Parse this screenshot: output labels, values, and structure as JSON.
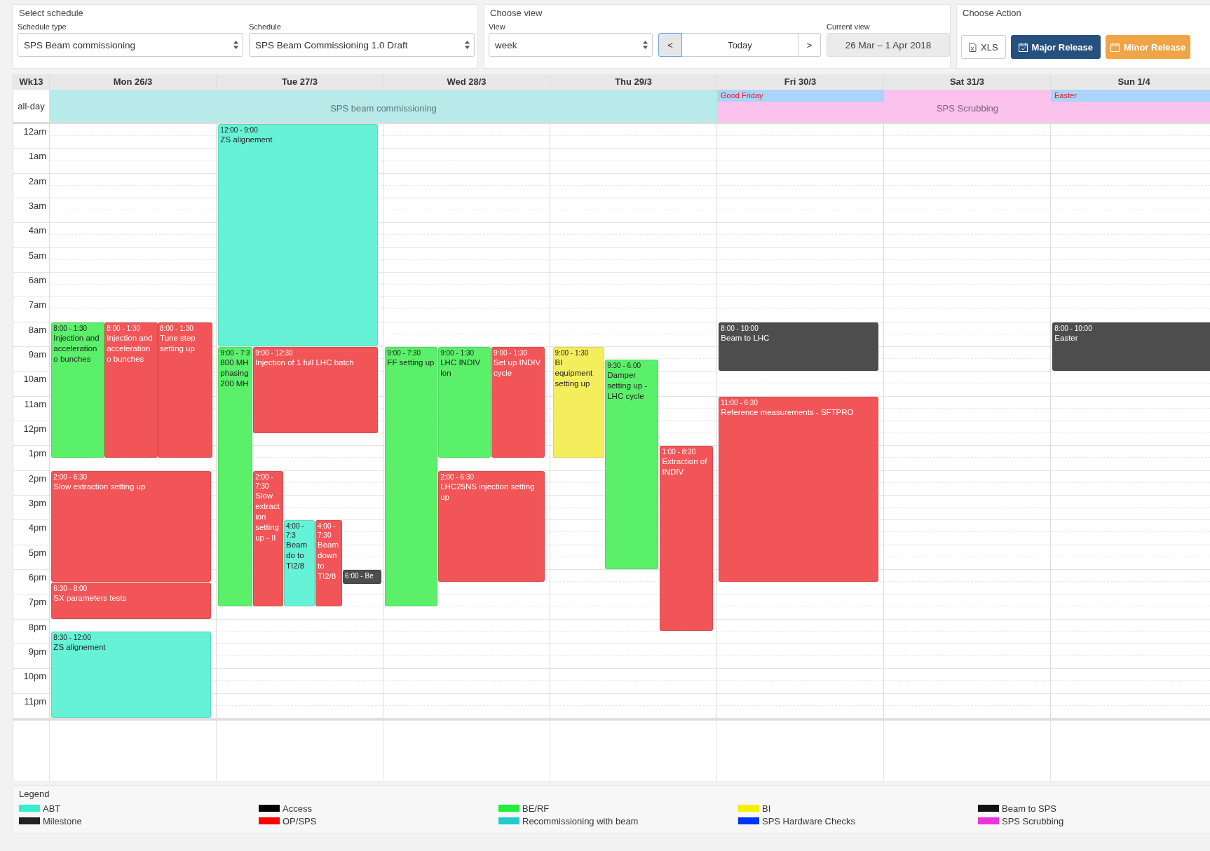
{
  "select_schedule": {
    "legend": "Select schedule",
    "fields": [
      {
        "label": "Schedule type",
        "value": "SPS Beam commissioning"
      },
      {
        "label": "Schedule",
        "value": "SPS Beam Commissioning 1.0 Draft"
      }
    ]
  },
  "choose_view": {
    "legend": "Choose view",
    "view_label": "View",
    "view_value": "week",
    "prev": "<",
    "today": "Today",
    "next": ">",
    "current_label": "Current view",
    "current_value": "26 Mar – 1 Apr 2018"
  },
  "choose_action": {
    "legend": "Choose Action",
    "buttons": [
      {
        "label": "XLS",
        "kind": "file"
      },
      {
        "label": "Major Release",
        "kind": "major"
      },
      {
        "label": "Minor Release",
        "kind": "minor"
      }
    ]
  },
  "calendar": {
    "week": "Wk13",
    "all_day_label": "all-day",
    "all_day": [
      {
        "title": "SPS beam commissioning",
        "color": "#b8eaea",
        "kind": "span"
      },
      {
        "title": "SPS Scrubbing",
        "color": "#fbc2ee",
        "kind": "span"
      },
      {
        "title": "Good Friday",
        "color": "#aad4f8",
        "kind": "flag"
      },
      {
        "title": "Easter",
        "color": "#aad4f8",
        "kind": "flag"
      }
    ],
    "hours": [
      "12am",
      "1am",
      "2am",
      "3am",
      "4am",
      "5am",
      "6am",
      "7am",
      "8am",
      "9am",
      "10am",
      "11am",
      "12pm",
      "1pm",
      "2pm",
      "3pm",
      "4pm",
      "5pm",
      "6pm",
      "7pm",
      "8pm",
      "9pm",
      "10pm",
      "11pm"
    ],
    "days": [
      {
        "label": "Mon 26/3",
        "events": [
          {
            "time": "8:00 - 1:30",
            "title": "Injection and acceleration o bunches",
            "color": "#5af06a"
          },
          {
            "time": "8:00 - 1:30",
            "title": "Injection and acceleration o bunches",
            "color": "#f25557"
          },
          {
            "time": "8:00 - 1:30",
            "title": "Tune step setting up",
            "color": "#f25557"
          },
          {
            "time": "2:00 - 6:30",
            "title": "Slow extraction setting up",
            "color": "#f25557"
          },
          {
            "time": "6:30 - 8:00",
            "title": "SX parameters tests",
            "color": "#f25557"
          },
          {
            "time": "8:30 - 12:00",
            "title": "ZS alignement",
            "color": "#66f2d6"
          }
        ]
      },
      {
        "label": "Tue 27/3",
        "events": [
          {
            "time": "12:00 - 9:00",
            "title": "ZS alignement",
            "color": "#66f2d6"
          },
          {
            "time": "9:00 - 7:3",
            "title": "800 MH phasing 200 MH",
            "color": "#5af06a"
          },
          {
            "time": "9:00 - 12:30",
            "title": "Injection of 1 full LHC batch",
            "color": "#f25557"
          },
          {
            "time": "2:00 - 7:30",
            "title": "Slow extraction setting up - II",
            "color": "#f25557"
          },
          {
            "time": "4:00 - 7:3",
            "title": "Beam do to TI2/8",
            "color": "#66f2d6"
          },
          {
            "time": "4:00 - 7:30",
            "title": "Beam down to TI2/8",
            "color": "#f25557"
          },
          {
            "time": "6:00 - Be",
            "color": "#4d4d4d"
          }
        ]
      },
      {
        "label": "Wed 28/3",
        "events": [
          {
            "time": "9:00 - 7:30",
            "title": "FF setting up",
            "color": "#5af06a"
          },
          {
            "time": "9:00 - 1:30",
            "title": "LHC INDIV lon",
            "color": "#5af06a"
          },
          {
            "time": "9:00 - 1:30",
            "title": "Set up INDIV cycle",
            "color": "#f25557"
          },
          {
            "time": "2:00 - 6:30",
            "title": "LHC25NS injection setting up",
            "color": "#f25557"
          }
        ]
      },
      {
        "label": "Thu 29/3",
        "events": [
          {
            "time": "9:00 - 1:30",
            "title": "BI equipment setting up",
            "color": "#f5ee5c"
          },
          {
            "time": "9:30 - 6:00",
            "title": "Damper setting up - LHC cycle",
            "color": "#5af06a"
          },
          {
            "time": "1:00 - 8:30",
            "title": "Extraction of INDIV",
            "color": "#f25557"
          }
        ]
      },
      {
        "label": "Fri 30/3",
        "events": [
          {
            "time": "8:00 - 10:00",
            "title": "Beam to LHC",
            "color": "#4d4d4d"
          },
          {
            "time": "11:00 - 6:30",
            "title": "Reference measurements - SFTPRO",
            "color": "#f25557"
          }
        ]
      },
      {
        "label": "Sat 31/3"
      },
      {
        "label": "Sun 1/4",
        "events": [
          {
            "time": "8:00 - 10:00",
            "title": "Easter",
            "color": "#4d4d4d"
          }
        ]
      }
    ]
  },
  "legend": {
    "title": "Legend",
    "items": [
      {
        "label": "ABT",
        "color": "#33f0cc"
      },
      {
        "label": "Access",
        "color": "#000000"
      },
      {
        "label": "BE/RF",
        "color": "#1ef03c"
      },
      {
        "label": "BI",
        "color": "#f5f000"
      },
      {
        "label": "Beam to SPS",
        "color": "#111111"
      },
      {
        "label": "Milestone",
        "color": "#222222"
      },
      {
        "label": "OP/SPS",
        "color": "#ff0000"
      },
      {
        "label": "Recommissioning with beam",
        "color": "#1ecccc"
      },
      {
        "label": "SPS Hardware Checks",
        "color": "#0033ff"
      },
      {
        "label": "SPS Scrubbing",
        "color": "#ee33dd"
      }
    ]
  }
}
